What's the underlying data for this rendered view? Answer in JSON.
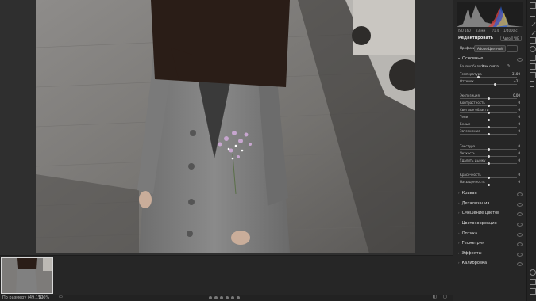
{
  "app": {
    "statusbar": {
      "fit_label": "По размеру (49,1%)",
      "zoom_label": "100%"
    }
  },
  "histogram_info": {
    "iso": "ISO 160",
    "focal": "23 мм",
    "aperture": "f/1.4",
    "shutter": "1/4000 с"
  },
  "panel": {
    "title": "Редактировать",
    "auto_label": "Авто",
    "bw_label": "Ч/Б",
    "tabs": [
      "Профиль",
      "Adobe Цветной"
    ],
    "basic": {
      "title": "Основные",
      "wb_label": "Баланс белого",
      "wb_value": "Как снято",
      "rows": [
        {
          "label": "Температура",
          "value": "3100",
          "pos": 0.33
        },
        {
          "label": "Оттенок",
          "value": "+21",
          "pos": 0.62
        },
        {
          "label": "Экспозиция",
          "value": "0,00",
          "pos": 0.5
        },
        {
          "label": "Контрастность",
          "value": "0",
          "pos": 0.5
        },
        {
          "label": "Светлые области",
          "value": "0",
          "pos": 0.5
        },
        {
          "label": "Тени",
          "value": "0",
          "pos": 0.5
        },
        {
          "label": "Белые",
          "value": "0",
          "pos": 0.5
        },
        {
          "label": "Затемнение",
          "value": "0",
          "pos": 0.5
        },
        {
          "label": "Текстура",
          "value": "0",
          "pos": 0.5
        },
        {
          "label": "Четкость",
          "value": "0",
          "pos": 0.5
        },
        {
          "label": "Удалить дымку",
          "value": "0",
          "pos": 0.5
        },
        {
          "label": "Красочность",
          "value": "0",
          "pos": 0.5
        },
        {
          "label": "Насыщенность",
          "value": "0",
          "pos": 0.5
        }
      ]
    },
    "sections": [
      "Кривая",
      "Детализация",
      "Смешение цветов",
      "Цветокоррекция",
      "Оптика",
      "Геометрия",
      "Эффекты",
      "Калибровка"
    ]
  },
  "colors": {
    "panel_bg": "#262626",
    "accent": "#ffffff"
  }
}
